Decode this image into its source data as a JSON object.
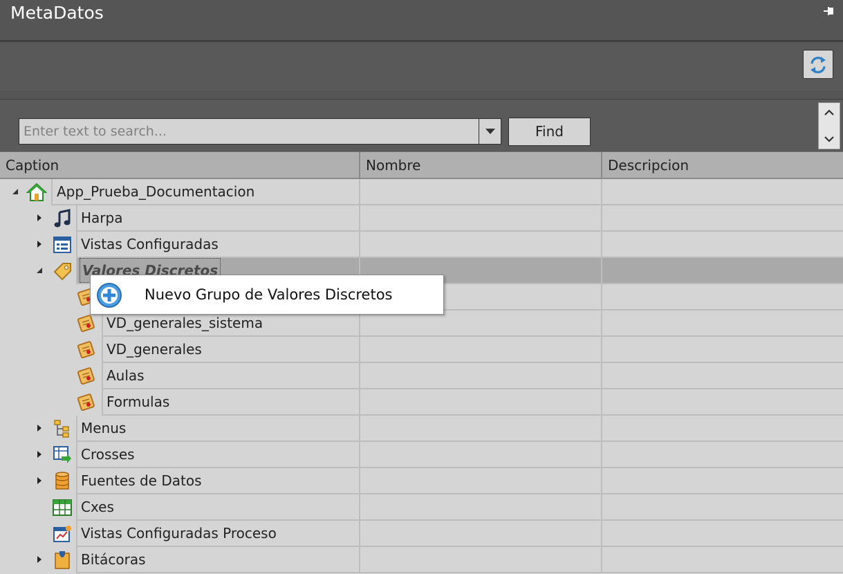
{
  "window": {
    "title": "MetaDatos"
  },
  "search": {
    "placeholder": "Enter text to search...",
    "find_label": "Find"
  },
  "columns": [
    "Caption",
    "Nombre",
    "Descripcion"
  ],
  "tree": [
    {
      "label": "App_Prueba_Documentacion",
      "icon": "home-icon",
      "level": 0,
      "expander": "expanded"
    },
    {
      "label": "Harpa",
      "icon": "music-note-icon",
      "level": 1,
      "expander": "collapsed"
    },
    {
      "label": "Vistas Configuradas",
      "icon": "form-list-icon",
      "level": 1,
      "expander": "collapsed"
    },
    {
      "label": "Valores Discretos",
      "icon": "tag-icon",
      "level": 1,
      "expander": "expanded",
      "selected": true
    },
    {
      "label": "",
      "icon": "value-group-icon",
      "level": 2
    },
    {
      "label": "VD_generales_sistema",
      "icon": "value-group-icon",
      "level": 2
    },
    {
      "label": "VD_generales",
      "icon": "value-group-icon",
      "level": 2
    },
    {
      "label": "Aulas",
      "icon": "value-group-icon",
      "level": 2
    },
    {
      "label": "Formulas",
      "icon": "value-group-icon",
      "level": 2
    },
    {
      "label": "Menus",
      "icon": "menu-tree-icon",
      "level": 1,
      "expander": "collapsed"
    },
    {
      "label": "Crosses",
      "icon": "crosses-icon",
      "level": 1,
      "expander": "collapsed"
    },
    {
      "label": "Fuentes de Datos",
      "icon": "database-icon",
      "level": 1,
      "expander": "collapsed"
    },
    {
      "label": "Cxes",
      "icon": "grid-icon",
      "level": 1
    },
    {
      "label": "Vistas Configuradas Proceso",
      "icon": "process-view-icon",
      "level": 1
    },
    {
      "label": "Bitácoras",
      "icon": "log-book-icon",
      "level": 1,
      "expander": "collapsed"
    }
  ],
  "context_menu": {
    "items": [
      {
        "label": "Nuevo Grupo de Valores Discretos",
        "icon": "add-circle-icon"
      }
    ]
  },
  "colors": {
    "panel": "#555555",
    "grid": "#d5d5d5",
    "selected_row": "#a9a9a9",
    "header": "#b0b0b0"
  }
}
